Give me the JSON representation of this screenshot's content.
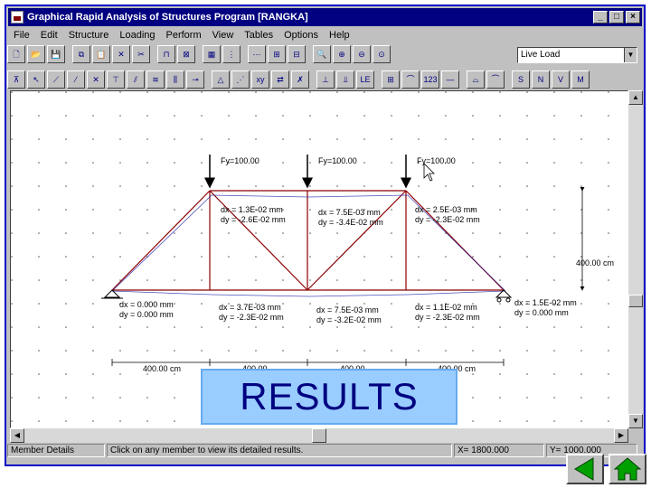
{
  "window": {
    "title": "Graphical Rapid Analysis of Structures Program [RANGKA]",
    "min_glyph": "_",
    "max_glyph": "□",
    "close_glyph": "×"
  },
  "menu": [
    "File",
    "Edit",
    "Structure",
    "Loading",
    "Perform",
    "View",
    "Tables",
    "Options",
    "Help"
  ],
  "toolbar": {
    "load_case_selected": "Live Load",
    "row2_labels": {
      "numbering": "123",
      "xy": "xy",
      "le": "LE",
      "s": "S",
      "n": "N",
      "v": "V",
      "m": "M"
    }
  },
  "truss": {
    "loads": [
      "Fy=100.00",
      "Fy=100.00",
      "Fy=100.00"
    ],
    "top_displacements": [
      {
        "dx": "dx =  1.3E-02 mm",
        "dy": "dy = -2.6E-02 mm"
      },
      {
        "dx": "dx =  7.5E-03 mm",
        "dy": "dy = -3.4E-02 mm"
      },
      {
        "dx": "dx =  2.5E-03 mm",
        "dy": "dy = -2.3E-02 mm"
      }
    ],
    "bottom_displacements": [
      {
        "dx": "dx =   0.000 mm",
        "dy": "dy =   0.000 mm"
      },
      {
        "dx": "dx =  3.7E-03 mm",
        "dy": "dy = -2.3E-02 mm"
      },
      {
        "dx": "dx =  7.5E-03 mm",
        "dy": "dy = -3.2E-02 mm"
      },
      {
        "dx": "dx =  1.1E-02 mm",
        "dy": "dy = -2.3E-02 mm"
      },
      {
        "dx": "dx =  1.5E-02 mm",
        "dy": "dy =   0.000 mm"
      }
    ],
    "height_dim": "400.00 cm",
    "span_dims": [
      "400.00 cm",
      "400.00",
      "400.00",
      "400.00 cm"
    ]
  },
  "status": {
    "section": "Member Details",
    "hint": "Click on any member to view its detailed results.",
    "x": "X= 1800.000",
    "y": "Y= 1000.000"
  },
  "banner": "RESULTS",
  "colors": {
    "truss_top": "#8b0000",
    "truss_bracing": "#cc3333",
    "deformed": "#2222aa",
    "banner_bg": "#99ccff",
    "nav_green": "#00a000"
  }
}
